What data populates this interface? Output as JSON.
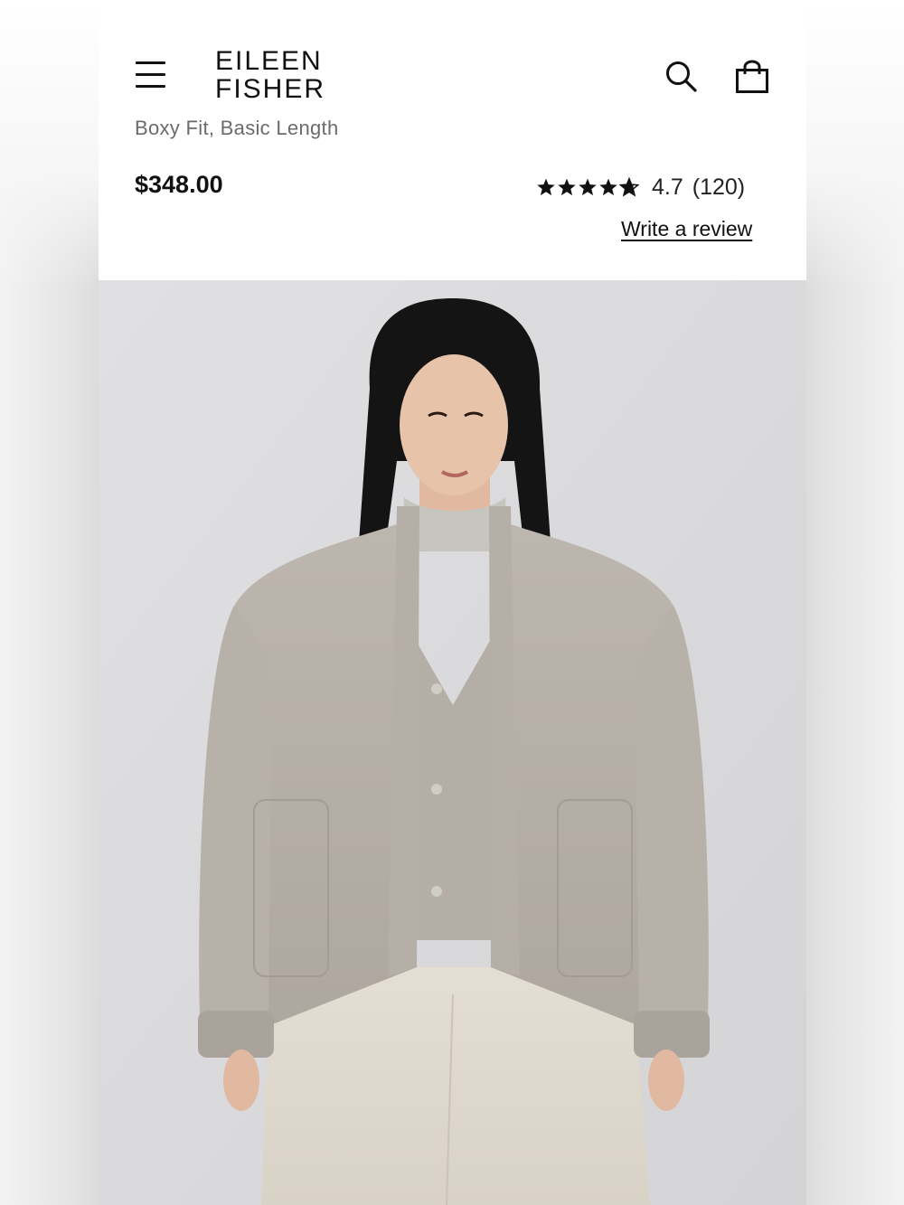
{
  "header": {
    "brand_line1": "EILEEN",
    "brand_line2": "FISHER",
    "menu_icon": "hamburger-menu-icon",
    "search_icon": "search-icon",
    "bag_icon": "shopping-bag-icon"
  },
  "product": {
    "subtitle": "Boxy Fit, Basic Length",
    "price": "$348.00",
    "rating": "4.7",
    "rating_fraction": 0.94,
    "review_count": "(120)",
    "write_review_label": "Write a review",
    "image_description_icon": "product-photo"
  }
}
